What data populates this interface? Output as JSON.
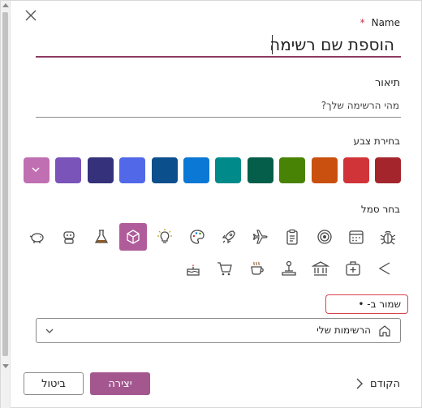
{
  "dialog": {
    "name_label": "Name",
    "required_mark": "*",
    "name_placeholder": "הוספת שם רשימה",
    "description_label": "תיאור",
    "description_placeholder": "מהי הרשימה שלך?",
    "color_label": "בחירת צבע",
    "icon_label": "בחר סמל",
    "save_location_label": "שמור ב- •",
    "save_location_value": "הרשימות שלי",
    "cancel_label": "ביטול",
    "create_label": "יצירה",
    "back_label": "הקודם"
  },
  "colors": [
    {
      "name": "pink",
      "hex": "#c06fb2",
      "selected": true
    },
    {
      "name": "purple",
      "hex": "#7a54b8",
      "selected": false
    },
    {
      "name": "navy",
      "hex": "#35317a",
      "selected": false
    },
    {
      "name": "blue",
      "hex": "#5169e8",
      "selected": false
    },
    {
      "name": "dark-blue",
      "hex": "#0b4f8c",
      "selected": false
    },
    {
      "name": "sky-blue",
      "hex": "#0a78d4",
      "selected": false
    },
    {
      "name": "teal",
      "hex": "#018a8a",
      "selected": false
    },
    {
      "name": "dark-green",
      "hex": "#045e4a",
      "selected": false
    },
    {
      "name": "green",
      "hex": "#498306",
      "selected": false
    },
    {
      "name": "orange",
      "hex": "#ca5010",
      "selected": false
    },
    {
      "name": "red",
      "hex": "#d13438",
      "selected": false
    },
    {
      "name": "dark-red",
      "hex": "#a4262c",
      "selected": false
    }
  ],
  "icons_row1": [
    "piggy-bank-icon",
    "robot-icon",
    "flask-icon",
    "cube-icon",
    "lightbulb-icon",
    "palette-icon",
    "rocket-icon",
    "airplane-icon",
    "clipboard-icon",
    "target-icon",
    "calendar-icon",
    "bug-icon"
  ],
  "icons_row2": [
    "cake-icon",
    "cart-icon",
    "coffee-cup-icon",
    "joystick-icon",
    "bank-icon",
    "medical-kit-icon",
    "triangle-play-icon"
  ],
  "selected_icon": "cube-icon",
  "accent": "#a3578e"
}
